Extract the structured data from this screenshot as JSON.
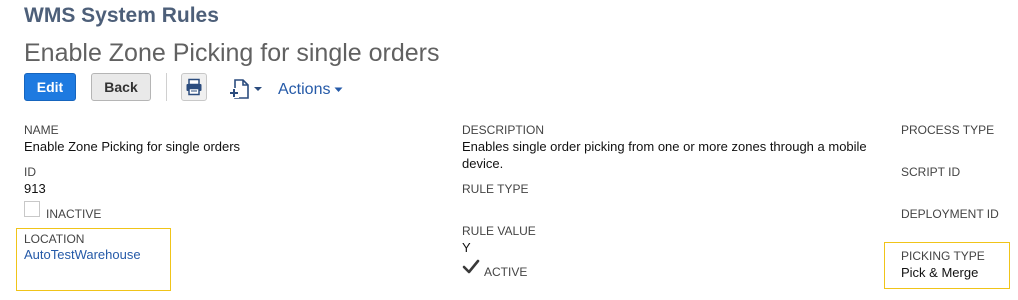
{
  "header": {
    "record_type": "WMS System Rules",
    "title": "Enable Zone Picking for single orders"
  },
  "toolbar": {
    "edit_label": "Edit",
    "back_label": "Back",
    "actions_label": "Actions"
  },
  "fields": {
    "name": {
      "label": "NAME",
      "value": "Enable Zone Picking for single orders"
    },
    "id": {
      "label": "ID",
      "value": "913"
    },
    "inactive": {
      "label": "INACTIVE",
      "checked": false
    },
    "location": {
      "label": "LOCATION",
      "value": "AutoTestWarehouse"
    },
    "description": {
      "label": "DESCRIPTION",
      "line1": "Enables single order picking from one or more zones through a mobile",
      "line2": "device."
    },
    "rule_type": {
      "label": "RULE TYPE",
      "value": ""
    },
    "rule_value": {
      "label": "RULE VALUE",
      "value": "Y"
    },
    "active": {
      "label": "ACTIVE",
      "checked": true
    },
    "process_type": {
      "label": "PROCESS TYPE",
      "value": ""
    },
    "script_id": {
      "label": "SCRIPT ID",
      "value": ""
    },
    "deployment_id": {
      "label": "DEPLOYMENT ID",
      "value": ""
    },
    "picking_type": {
      "label": "PICKING TYPE",
      "value": "Pick & Merge"
    }
  },
  "colors": {
    "title_blue": "#4d5f79",
    "edit_button": "#1e7ae0",
    "link": "#255aa8",
    "highlight_border": "#f0c419"
  }
}
